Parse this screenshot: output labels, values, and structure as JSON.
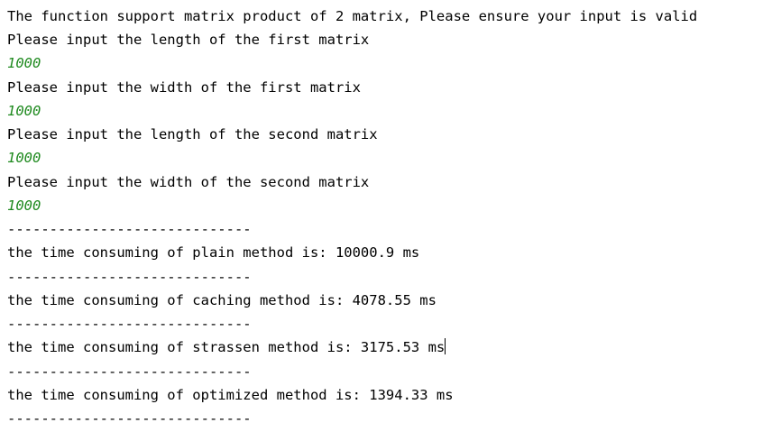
{
  "console": {
    "lines": [
      {
        "kind": "output",
        "text": "The function support matrix product of 2 matrix, Please ensure your input is valid"
      },
      {
        "kind": "output",
        "text": "Please input the length of the first matrix"
      },
      {
        "kind": "input",
        "text": "1000"
      },
      {
        "kind": "output",
        "text": "Please input the width of the first matrix"
      },
      {
        "kind": "input",
        "text": "1000"
      },
      {
        "kind": "output",
        "text": "Please input the length of the second matrix"
      },
      {
        "kind": "input",
        "text": "1000"
      },
      {
        "kind": "output",
        "text": "Please input the width of the second matrix"
      },
      {
        "kind": "input",
        "text": "1000"
      },
      {
        "kind": "separator",
        "text": "-----------------------------"
      },
      {
        "kind": "output",
        "text": "the time consuming of plain method is: 10000.9 ms"
      },
      {
        "kind": "separator",
        "text": "-----------------------------"
      },
      {
        "kind": "output",
        "text": "the time consuming of caching method is: 4078.55 ms"
      },
      {
        "kind": "separator",
        "text": "-----------------------------"
      },
      {
        "kind": "output",
        "text": "the time consuming of strassen method is: 3175.53 ms"
      },
      {
        "kind": "separator",
        "text": "-----------------------------"
      },
      {
        "kind": "output",
        "text": "the time consuming of optimized method is: 1394.33 ms"
      },
      {
        "kind": "separator",
        "text": "-----------------------------"
      }
    ]
  },
  "colors": {
    "background": "#ffffff",
    "output_text": "#000000",
    "input_text": "#1f8a1f"
  }
}
